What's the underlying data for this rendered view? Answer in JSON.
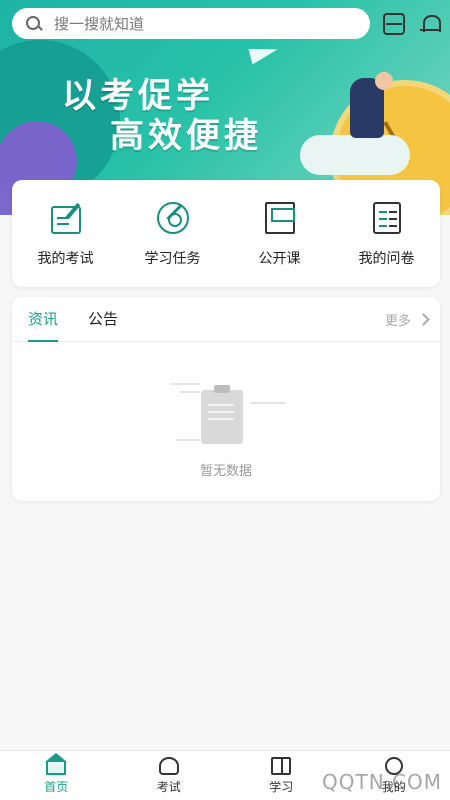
{
  "search": {
    "placeholder": "搜一搜就知道"
  },
  "header": {
    "scan_icon": "scan-icon",
    "bell_icon": "bell-icon"
  },
  "banner": {
    "line1": "以考促学",
    "line2": "高效便捷"
  },
  "quick_menu": [
    {
      "label": "我的考试",
      "icon": "exam-edit-icon"
    },
    {
      "label": "学习任务",
      "icon": "target-icon"
    },
    {
      "label": "公开课",
      "icon": "book-icon"
    },
    {
      "label": "我的问卷",
      "icon": "checklist-icon"
    }
  ],
  "news": {
    "tabs": [
      {
        "label": "资讯",
        "active": true
      },
      {
        "label": "公告",
        "active": false
      }
    ],
    "more": "更多",
    "empty_text": "暂无数据"
  },
  "bottom_nav": [
    {
      "label": "首页",
      "active": true,
      "icon": "home-icon"
    },
    {
      "label": "考试",
      "active": false,
      "icon": "exam-icon"
    },
    {
      "label": "学习",
      "active": false,
      "icon": "book-open-icon"
    },
    {
      "label": "我的",
      "active": false,
      "icon": "user-icon"
    }
  ],
  "watermark": "QQTN.COM",
  "colors": {
    "accent": "#1a9a8a",
    "banner": "#1fb2a6"
  }
}
